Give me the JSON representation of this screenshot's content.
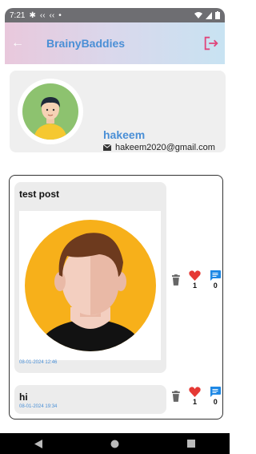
{
  "status": {
    "time": "7:21",
    "dot": "•"
  },
  "app": {
    "title": "BrainyBaddies"
  },
  "profile": {
    "username": "hakeem",
    "email": "hakeem2020@gmail.com"
  },
  "posts": [
    {
      "title": "test post",
      "date": "08-01-2024 12:46",
      "likes": "1",
      "comments": "0",
      "has_image": true
    },
    {
      "title": "hi",
      "date": "08-01-2024 19:34",
      "likes": "1",
      "comments": "0",
      "has_image": false
    }
  ],
  "colors": {
    "accent": "#4a8fd6",
    "like": "#e53935",
    "comment": "#1e88e5",
    "logout": "#e0457b"
  }
}
